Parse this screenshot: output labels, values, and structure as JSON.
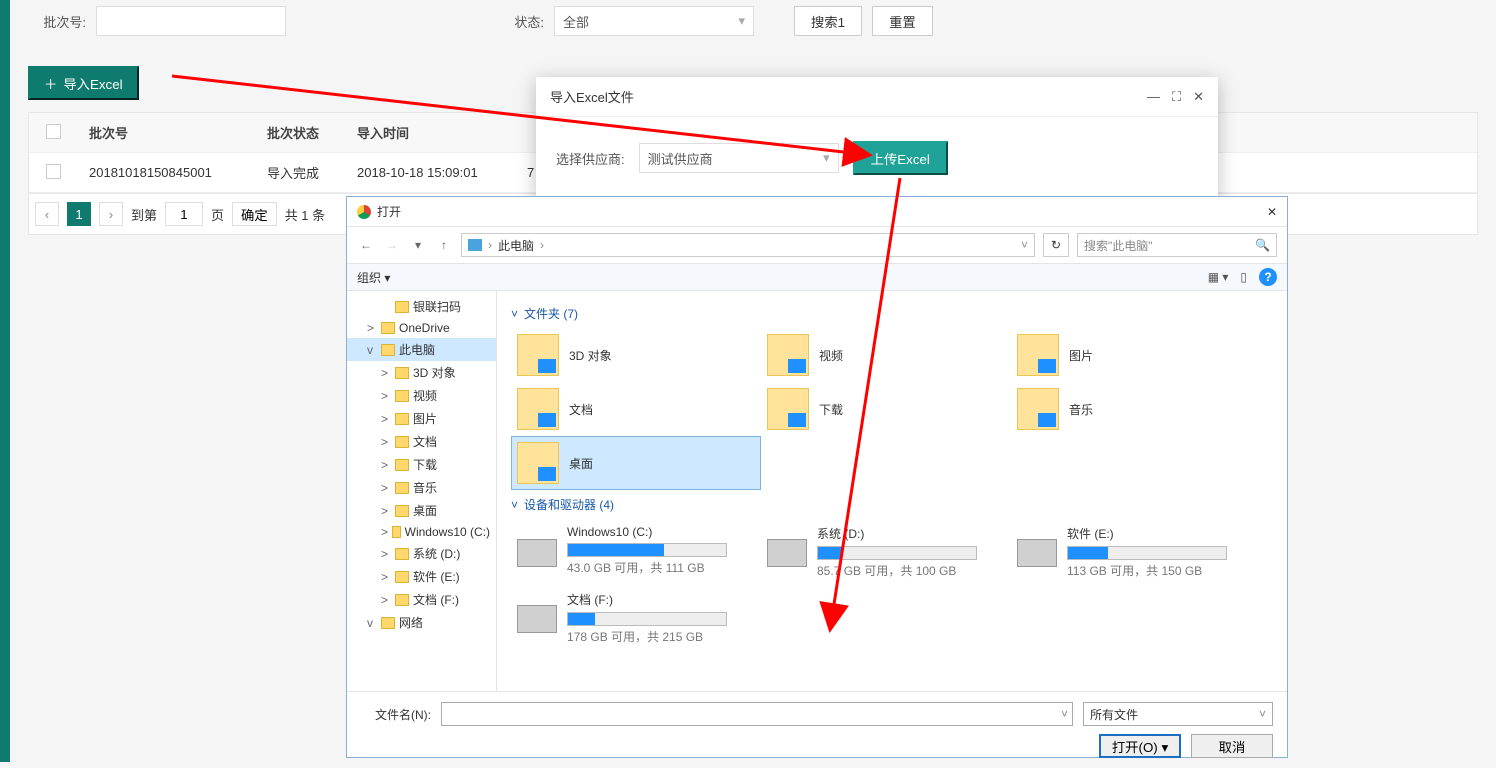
{
  "filters": {
    "batch_label": "批次号:",
    "status_label": "状态:",
    "status_value": "全部",
    "search_btn": "搜索1",
    "reset_btn": "重置"
  },
  "import_btn": "导入Excel",
  "table": {
    "headers": {
      "batch": "批次号",
      "status": "批次状态",
      "time": "导入时间"
    },
    "rows": [
      {
        "batch": "20181018150845001",
        "status": "导入完成",
        "time": "2018-10-18 15:09:01",
        "rest": "7"
      }
    ]
  },
  "pager": {
    "current": "1",
    "goto_prefix": "到第",
    "goto_value": "1",
    "goto_suffix": "页",
    "confirm": "确定",
    "total": "共 1 条"
  },
  "modal": {
    "title": "导入Excel文件",
    "supplier_label": "选择供应商:",
    "supplier_value": "测试供应商",
    "upload_btn": "上传Excel"
  },
  "filedlg": {
    "title": "打开",
    "breadcrumb_root": "此电脑",
    "search_placeholder": "搜索\"此电脑\"",
    "toolbar_org": "组织",
    "group_folders": "文件夹 (7)",
    "group_drives": "设备和驱动器 (4)",
    "tree": [
      {
        "label": "银联扫码",
        "kind": "folder",
        "indent": 2
      },
      {
        "label": "OneDrive",
        "kind": "cloud",
        "indent": 1,
        "exp": ">"
      },
      {
        "label": "此电脑",
        "kind": "pc",
        "indent": 1,
        "exp": "v",
        "selected": true
      },
      {
        "label": "3D 对象",
        "kind": "3d",
        "indent": 2,
        "exp": ">"
      },
      {
        "label": "视频",
        "kind": "video",
        "indent": 2,
        "exp": ">"
      },
      {
        "label": "图片",
        "kind": "pic",
        "indent": 2,
        "exp": ">"
      },
      {
        "label": "文档",
        "kind": "doc",
        "indent": 2,
        "exp": ">"
      },
      {
        "label": "下载",
        "kind": "dl",
        "indent": 2,
        "exp": ">"
      },
      {
        "label": "音乐",
        "kind": "music",
        "indent": 2,
        "exp": ">"
      },
      {
        "label": "桌面",
        "kind": "desk",
        "indent": 2,
        "exp": ">"
      },
      {
        "label": "Windows10 (C:)",
        "kind": "drive",
        "indent": 2,
        "exp": ">"
      },
      {
        "label": "系统 (D:)",
        "kind": "drive",
        "indent": 2,
        "exp": ">"
      },
      {
        "label": "软件 (E:)",
        "kind": "drive",
        "indent": 2,
        "exp": ">"
      },
      {
        "label": "文档 (F:)",
        "kind": "drive",
        "indent": 2,
        "exp": ">"
      },
      {
        "label": "网络",
        "kind": "net",
        "indent": 1,
        "exp": "v"
      }
    ],
    "folders": [
      {
        "label": "3D 对象"
      },
      {
        "label": "视频"
      },
      {
        "label": "图片"
      },
      {
        "label": "文档"
      },
      {
        "label": "下载"
      },
      {
        "label": "音乐"
      },
      {
        "label": "桌面",
        "selected": true
      }
    ],
    "drives": [
      {
        "name": "Windows10 (C:)",
        "info": "43.0 GB 可用，共 111 GB",
        "fill": 61
      },
      {
        "name": "系统 (D:)",
        "info": "85.7 GB 可用，共 100 GB",
        "fill": 15
      },
      {
        "name": "软件 (E:)",
        "info": "113 GB 可用，共 150 GB",
        "fill": 25
      },
      {
        "name": "文档 (F:)",
        "info": "178 GB 可用，共 215 GB",
        "fill": 17
      }
    ],
    "filename_label": "文件名(N):",
    "filetype": "所有文件",
    "open_btn": "打开(O)",
    "cancel_btn": "取消"
  }
}
